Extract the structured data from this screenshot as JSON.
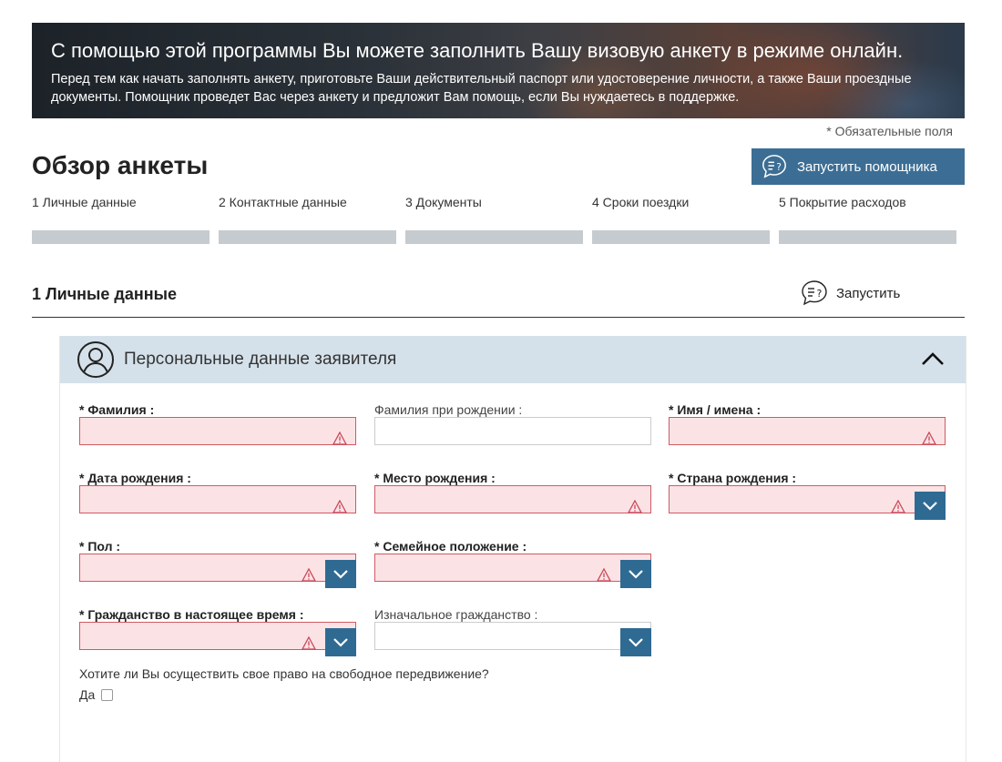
{
  "banner": {
    "title": "С помощью этой программы Вы можете заполнить Вашу визовую анкету в режиме онлайн.",
    "text": "Перед тем как начать заполнять анкету, приготовьте Ваши действительный паспорт или удостоверение личности, а также Ваши проездные документы. Помощник проведет Вас через анкету и предложит Вам помощь, если Вы нуждаетесь в поддержке."
  },
  "required_note": "* Обязательные поля",
  "page_title": "Обзор анкеты",
  "assistant_button": {
    "label": "Запустить помощника",
    "icon": "chat-question-icon"
  },
  "steps": [
    {
      "label": "1 Личные данные"
    },
    {
      "label": "2 Контактные данные"
    },
    {
      "label": "3 Документы"
    },
    {
      "label": "4 Сроки поездки"
    },
    {
      "label": "5 Покрытие расходов"
    }
  ],
  "section": {
    "title": "1 Личные данные",
    "launch_label": "Запустить"
  },
  "panel": {
    "title": "Персональные данные заявителя"
  },
  "fields": {
    "surname": {
      "label": "* Фамилия :",
      "value": ""
    },
    "birth_surname": {
      "label": "Фамилия при рождении :",
      "value": ""
    },
    "given_names": {
      "label": "* Имя / имена :",
      "value": ""
    },
    "birth_date": {
      "label": "* Дата рождения :",
      "value": ""
    },
    "birth_place": {
      "label": "* Место рождения :",
      "value": ""
    },
    "birth_country": {
      "label": "* Страна рождения :",
      "value": ""
    },
    "sex": {
      "label": "* Пол :",
      "value": ""
    },
    "marital_status": {
      "label": "* Семейное положение :",
      "value": ""
    },
    "current_citizenship": {
      "label": "* Гражданство в настоящее время :",
      "value": ""
    },
    "original_citizenship": {
      "label": "Изначальное гражданство :",
      "value": ""
    }
  },
  "free_movement": {
    "question": "Хотите ли Вы осуществить свое право на свободное передвижение?",
    "yes_label": "Да",
    "checked": false
  },
  "colors": {
    "accent": "#3c6e95",
    "dropdown": "#2f6a93",
    "error_bg": "#fbe3e5",
    "error_border": "#cf5a64",
    "panel_header": "#d5e1ea",
    "progress_bar": "#c6cbcf"
  }
}
